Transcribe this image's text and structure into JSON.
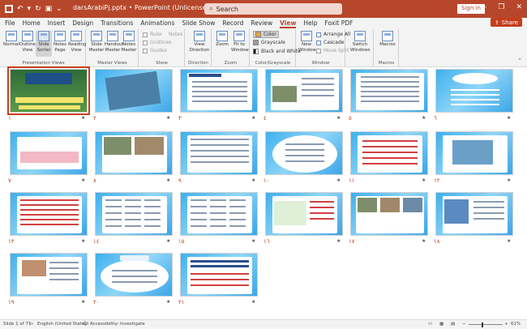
{
  "window": {
    "file_name": "darsArabiPj.pptx",
    "separator": "•",
    "app_name": "PowerPoint (Unlicensed Product)",
    "search_placeholder": "Search",
    "sign_in": "Sign in",
    "share": "Share",
    "accent": "#b7472a"
  },
  "tabs": [
    "File",
    "Home",
    "Insert",
    "Design",
    "Transitions",
    "Animations",
    "Slide Show",
    "Record",
    "Review",
    "View",
    "Help",
    "Foxit PDF"
  ],
  "active_tab": "View",
  "ribbon": {
    "presentation_views": {
      "label": "Presentation Views",
      "buttons": [
        {
          "line1": "Normal",
          "line2": ""
        },
        {
          "line1": "Outline",
          "line2": "View"
        },
        {
          "line1": "Slide",
          "line2": "Sorter"
        },
        {
          "line1": "Notes",
          "line2": "Page"
        },
        {
          "line1": "Reading",
          "line2": "View"
        }
      ]
    },
    "master_views": {
      "label": "Master Views",
      "buttons": [
        {
          "line1": "Slide",
          "line2": "Master"
        },
        {
          "line1": "Handout",
          "line2": "Master"
        },
        {
          "line1": "Notes",
          "line2": "Master"
        }
      ]
    },
    "show": {
      "label": "Show",
      "items": [
        "Ruler",
        "Gridlines",
        "Guides"
      ],
      "notes": "Notes"
    },
    "direction": {
      "label": "Direction",
      "line1": "View",
      "line2": "Direction"
    },
    "zoom": {
      "label": "Zoom",
      "buttons": [
        {
          "line1": "Zoom",
          "line2": ""
        },
        {
          "line1": "Fit to",
          "line2": "Window"
        }
      ]
    },
    "color_grayscale": {
      "label": "Color/Grayscale",
      "items": [
        "Color",
        "Grayscale",
        "Black and White"
      ]
    },
    "window": {
      "label": "Window",
      "new_window_1": "New",
      "new_window_2": "Window",
      "items": [
        "Arrange All",
        "Cascade",
        "Move Split"
      ]
    },
    "switch": {
      "line1": "Switch",
      "line2": "Windows"
    },
    "macros": {
      "label": "Macros",
      "button": "Macros"
    }
  },
  "slides": [
    {
      "num": "١",
      "selected": true
    },
    {
      "num": "٢"
    },
    {
      "num": "٣"
    },
    {
      "num": "٤"
    },
    {
      "num": "٥"
    },
    {
      "num": "٦"
    },
    {
      "num": "٧"
    },
    {
      "num": "٨"
    },
    {
      "num": "٩"
    },
    {
      "num": "١٠"
    },
    {
      "num": "١١"
    },
    {
      "num": "١٢"
    },
    {
      "num": "١٣"
    },
    {
      "num": "١٤"
    },
    {
      "num": "١٥"
    },
    {
      "num": "١٦"
    },
    {
      "num": "١٧"
    },
    {
      "num": "١٨"
    },
    {
      "num": "١٩"
    },
    {
      "num": "٢٠"
    },
    {
      "num": "٢١"
    }
  ],
  "slide_star": "★",
  "status": {
    "slide_count": "Slide 1 of 71",
    "language": "English (United States)",
    "accessibility": "Accessibility: Investigate",
    "zoom_minus": "−",
    "zoom_plus": "+",
    "zoom_level": "61%"
  }
}
